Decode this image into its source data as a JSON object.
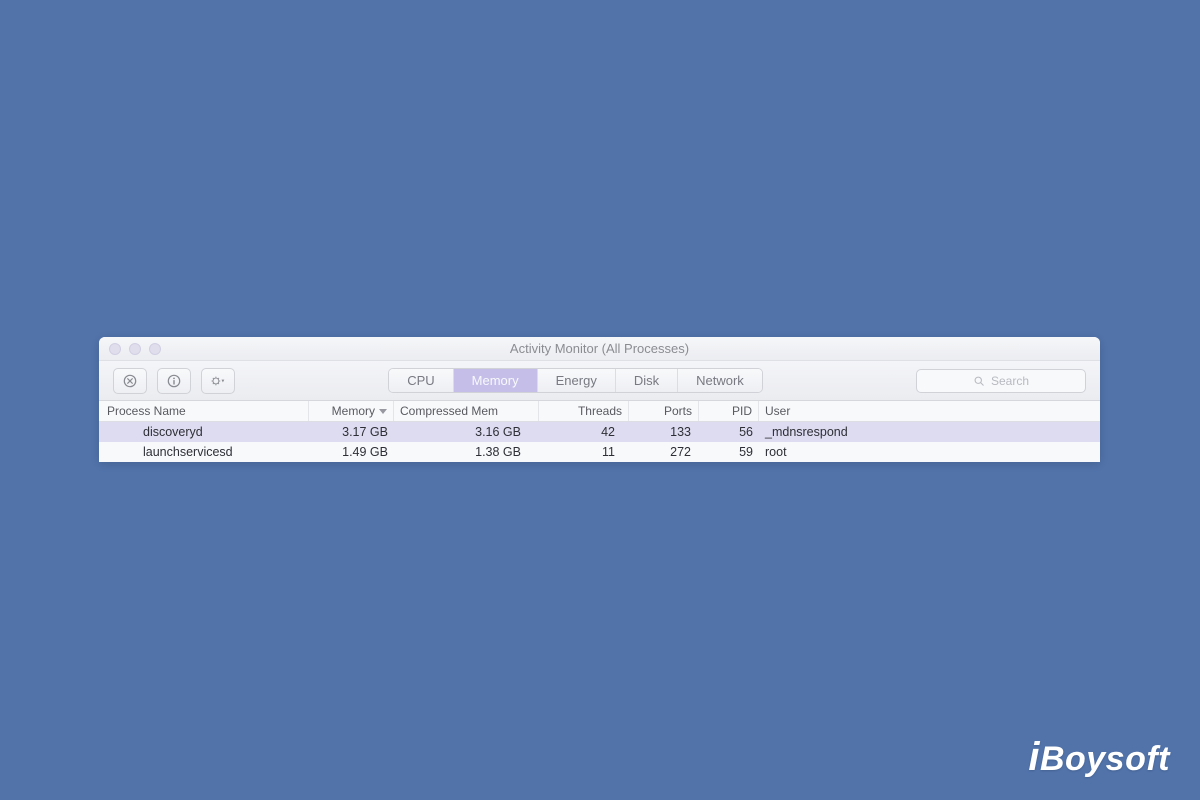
{
  "window": {
    "title": "Activity Monitor (All Processes)"
  },
  "toolbar": {
    "stop_label": "stop",
    "info_label": "info",
    "gear_label": "settings",
    "tabs": [
      "CPU",
      "Memory",
      "Energy",
      "Disk",
      "Network"
    ],
    "active_tab": "Memory",
    "search_placeholder": "Search"
  },
  "columns": {
    "name": "Process Name",
    "memory": "Memory",
    "cm": "Compressed Mem",
    "threads": "Threads",
    "ports": "Ports",
    "pid": "PID",
    "user": "User",
    "sorted": "memory",
    "sort_dir": "desc"
  },
  "rows": [
    {
      "name": "discoveryd",
      "memory": "3.17 GB",
      "cm": "3.16 GB",
      "threads": "42",
      "ports": "133",
      "pid": "56",
      "user": "_mdnsrespond",
      "selected": true
    },
    {
      "name": "launchservicesd",
      "memory": "1.49 GB",
      "cm": "1.38 GB",
      "threads": "11",
      "ports": "272",
      "pid": "59",
      "user": "root",
      "selected": false
    }
  ],
  "watermark": "iBoysoft"
}
